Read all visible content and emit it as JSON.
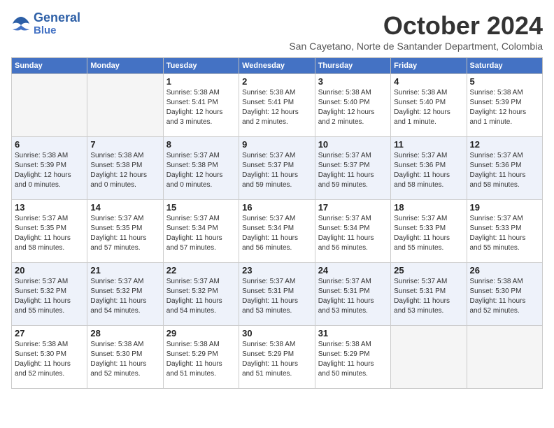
{
  "logo": {
    "line1": "General",
    "line2": "Blue"
  },
  "title": "October 2024",
  "location": "San Cayetano, Norte de Santander Department, Colombia",
  "weekdays": [
    "Sunday",
    "Monday",
    "Tuesday",
    "Wednesday",
    "Thursday",
    "Friday",
    "Saturday"
  ],
  "weeks": [
    [
      {
        "day": "",
        "info": ""
      },
      {
        "day": "",
        "info": ""
      },
      {
        "day": "1",
        "info": "Sunrise: 5:38 AM\nSunset: 5:41 PM\nDaylight: 12 hours\nand 3 minutes."
      },
      {
        "day": "2",
        "info": "Sunrise: 5:38 AM\nSunset: 5:41 PM\nDaylight: 12 hours\nand 2 minutes."
      },
      {
        "day": "3",
        "info": "Sunrise: 5:38 AM\nSunset: 5:40 PM\nDaylight: 12 hours\nand 2 minutes."
      },
      {
        "day": "4",
        "info": "Sunrise: 5:38 AM\nSunset: 5:40 PM\nDaylight: 12 hours\nand 1 minute."
      },
      {
        "day": "5",
        "info": "Sunrise: 5:38 AM\nSunset: 5:39 PM\nDaylight: 12 hours\nand 1 minute."
      }
    ],
    [
      {
        "day": "6",
        "info": "Sunrise: 5:38 AM\nSunset: 5:39 PM\nDaylight: 12 hours\nand 0 minutes."
      },
      {
        "day": "7",
        "info": "Sunrise: 5:38 AM\nSunset: 5:38 PM\nDaylight: 12 hours\nand 0 minutes."
      },
      {
        "day": "8",
        "info": "Sunrise: 5:37 AM\nSunset: 5:38 PM\nDaylight: 12 hours\nand 0 minutes."
      },
      {
        "day": "9",
        "info": "Sunrise: 5:37 AM\nSunset: 5:37 PM\nDaylight: 11 hours\nand 59 minutes."
      },
      {
        "day": "10",
        "info": "Sunrise: 5:37 AM\nSunset: 5:37 PM\nDaylight: 11 hours\nand 59 minutes."
      },
      {
        "day": "11",
        "info": "Sunrise: 5:37 AM\nSunset: 5:36 PM\nDaylight: 11 hours\nand 58 minutes."
      },
      {
        "day": "12",
        "info": "Sunrise: 5:37 AM\nSunset: 5:36 PM\nDaylight: 11 hours\nand 58 minutes."
      }
    ],
    [
      {
        "day": "13",
        "info": "Sunrise: 5:37 AM\nSunset: 5:35 PM\nDaylight: 11 hours\nand 58 minutes."
      },
      {
        "day": "14",
        "info": "Sunrise: 5:37 AM\nSunset: 5:35 PM\nDaylight: 11 hours\nand 57 minutes."
      },
      {
        "day": "15",
        "info": "Sunrise: 5:37 AM\nSunset: 5:34 PM\nDaylight: 11 hours\nand 57 minutes."
      },
      {
        "day": "16",
        "info": "Sunrise: 5:37 AM\nSunset: 5:34 PM\nDaylight: 11 hours\nand 56 minutes."
      },
      {
        "day": "17",
        "info": "Sunrise: 5:37 AM\nSunset: 5:34 PM\nDaylight: 11 hours\nand 56 minutes."
      },
      {
        "day": "18",
        "info": "Sunrise: 5:37 AM\nSunset: 5:33 PM\nDaylight: 11 hours\nand 55 minutes."
      },
      {
        "day": "19",
        "info": "Sunrise: 5:37 AM\nSunset: 5:33 PM\nDaylight: 11 hours\nand 55 minutes."
      }
    ],
    [
      {
        "day": "20",
        "info": "Sunrise: 5:37 AM\nSunset: 5:32 PM\nDaylight: 11 hours\nand 55 minutes."
      },
      {
        "day": "21",
        "info": "Sunrise: 5:37 AM\nSunset: 5:32 PM\nDaylight: 11 hours\nand 54 minutes."
      },
      {
        "day": "22",
        "info": "Sunrise: 5:37 AM\nSunset: 5:32 PM\nDaylight: 11 hours\nand 54 minutes."
      },
      {
        "day": "23",
        "info": "Sunrise: 5:37 AM\nSunset: 5:31 PM\nDaylight: 11 hours\nand 53 minutes."
      },
      {
        "day": "24",
        "info": "Sunrise: 5:37 AM\nSunset: 5:31 PM\nDaylight: 11 hours\nand 53 minutes."
      },
      {
        "day": "25",
        "info": "Sunrise: 5:37 AM\nSunset: 5:31 PM\nDaylight: 11 hours\nand 53 minutes."
      },
      {
        "day": "26",
        "info": "Sunrise: 5:38 AM\nSunset: 5:30 PM\nDaylight: 11 hours\nand 52 minutes."
      }
    ],
    [
      {
        "day": "27",
        "info": "Sunrise: 5:38 AM\nSunset: 5:30 PM\nDaylight: 11 hours\nand 52 minutes."
      },
      {
        "day": "28",
        "info": "Sunrise: 5:38 AM\nSunset: 5:30 PM\nDaylight: 11 hours\nand 52 minutes."
      },
      {
        "day": "29",
        "info": "Sunrise: 5:38 AM\nSunset: 5:29 PM\nDaylight: 11 hours\nand 51 minutes."
      },
      {
        "day": "30",
        "info": "Sunrise: 5:38 AM\nSunset: 5:29 PM\nDaylight: 11 hours\nand 51 minutes."
      },
      {
        "day": "31",
        "info": "Sunrise: 5:38 AM\nSunset: 5:29 PM\nDaylight: 11 hours\nand 50 minutes."
      },
      {
        "day": "",
        "info": ""
      },
      {
        "day": "",
        "info": ""
      }
    ]
  ]
}
